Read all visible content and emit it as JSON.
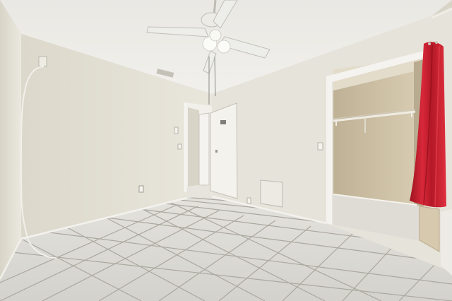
{
  "scene": {
    "subject": "empty bedroom",
    "colors": {
      "ceiling": "#ecebe6",
      "wall_left": "#e6e3d9",
      "wall_back": "#e3dfd3",
      "wall_right": "#e8e5dc",
      "closet_wall": "#cfc2a7",
      "floor": "#dcdbd6",
      "grout": "#a8a59d",
      "curtain": "#c81e2c",
      "door": "#f1f0ea",
      "trim": "#f3f2ee"
    },
    "objects": {
      "ceiling_fan": "ceiling-fan-icon",
      "curtain": "curtain-icon",
      "closet_rod": "closet-rod-icon"
    }
  }
}
